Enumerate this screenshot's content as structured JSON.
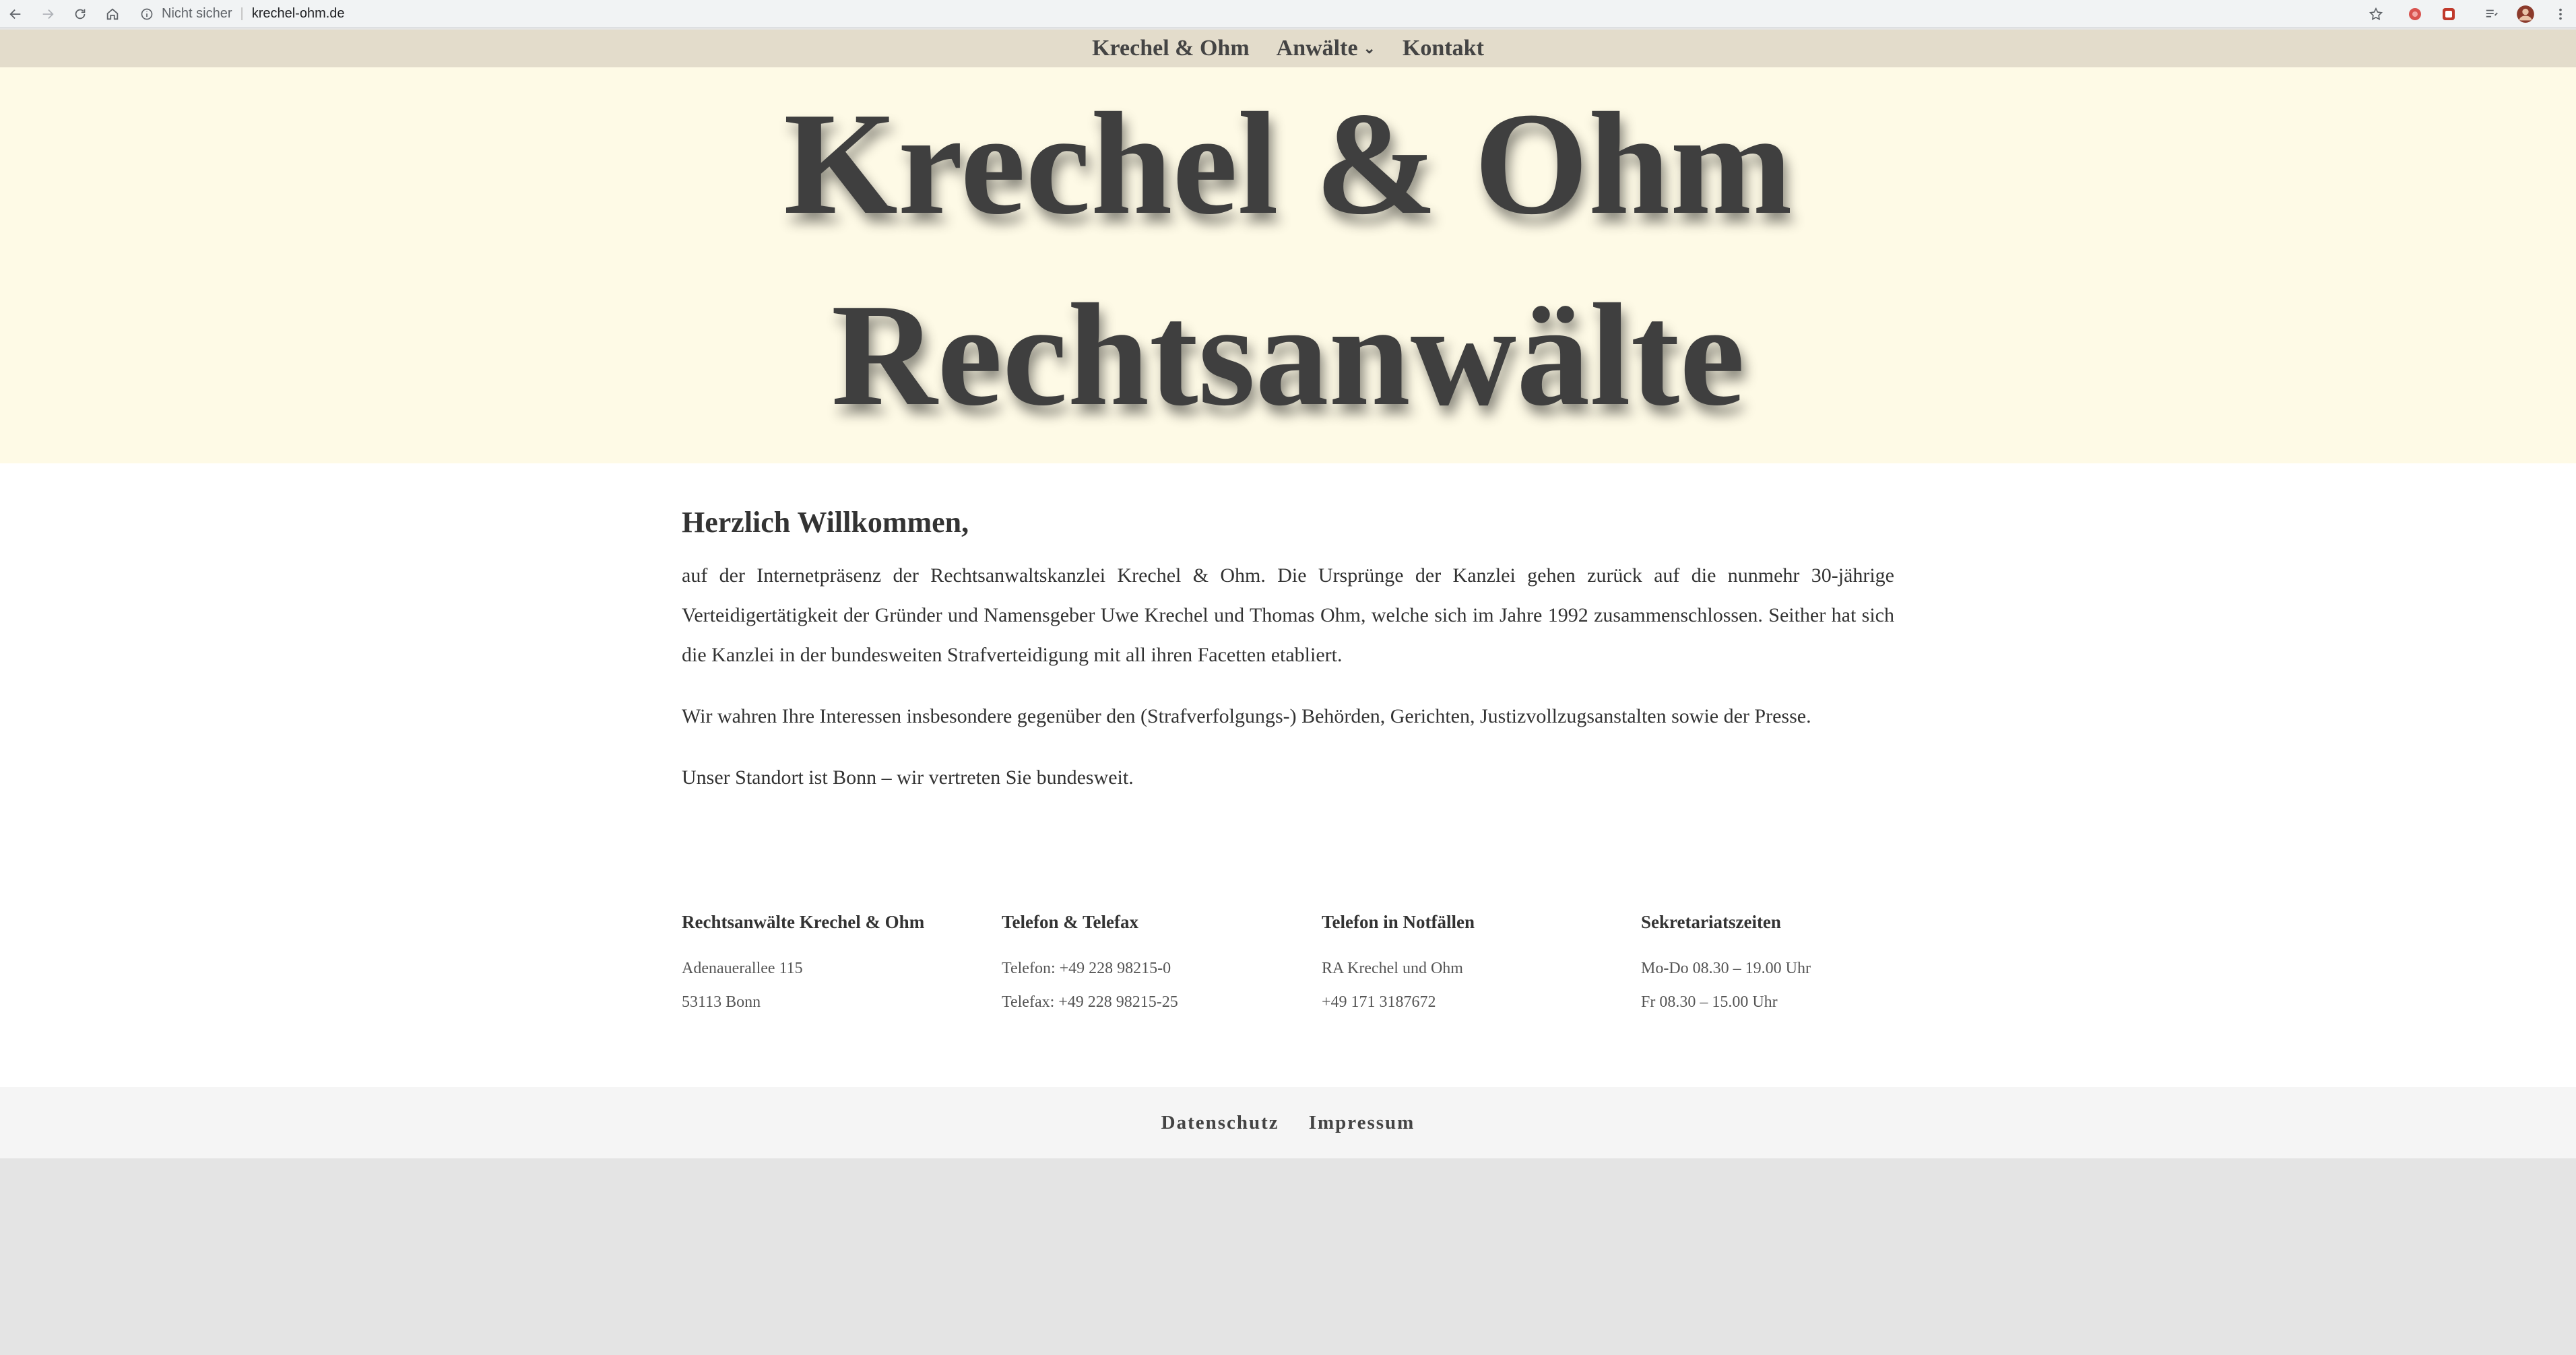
{
  "browser": {
    "security_label": "Nicht sicher",
    "url": "krechel-ohm.de"
  },
  "site_nav": {
    "items": [
      "Krechel & Ohm",
      "Anwälte",
      "Kontakt"
    ]
  },
  "hero": {
    "line1": "Krechel & Ohm",
    "line2": "Rechtsanwälte"
  },
  "article": {
    "heading": "Herzlich Willkommen,",
    "paragraphs": [
      "auf der Internetpräsenz der Rechtsanwaltskanzlei Krechel & Ohm. Die Ursprünge der Kanzlei gehen zurück auf die nunmehr 30-jährige Verteidigertätigkeit der Gründer und Namensgeber Uwe Krechel und Thomas Ohm, welche sich im Jahre 1992 zusammenschlossen. Seither hat sich die Kanzlei in der bundesweiten Strafverteidigung mit all ihren Facetten etabliert.",
      "Wir wahren Ihre Interessen insbesondere gegenüber den (Strafverfolgungs-) Behörden, Gerichten, Justizvollzugsanstalten sowie der Presse.",
      "Unser Standort ist Bonn – wir vertreten Sie bundesweit."
    ]
  },
  "footer_columns": [
    {
      "title": "Rechtsanwälte Krechel & Ohm",
      "lines": [
        "Adenauerallee 115",
        "53113 Bonn"
      ]
    },
    {
      "title": "Telefon & Telefax",
      "lines": [
        "Telefon: +49 228 98215-0",
        "Telefax: +49 228 98215-25"
      ]
    },
    {
      "title": "Telefon in Notfällen",
      "lines": [
        "RA Krechel und Ohm",
        "+49 171 3187672"
      ]
    },
    {
      "title": "Sekretariatszeiten",
      "lines": [
        "Mo-Do 08.30 – 19.00 Uhr",
        "Fr 08.30 – 15.00 Uhr"
      ]
    }
  ],
  "bottom_links": [
    "Datenschutz",
    "Impressum"
  ]
}
